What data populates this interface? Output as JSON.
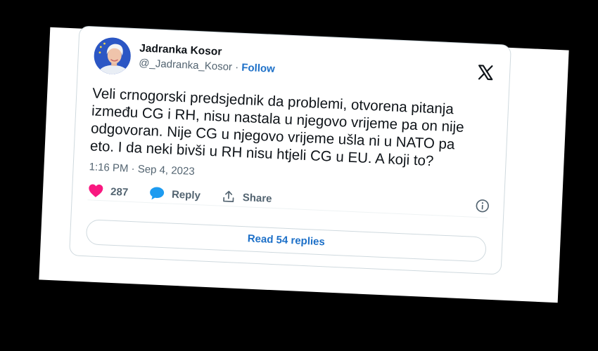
{
  "tweet": {
    "author_name": "Jadranka Kosor",
    "handle": "@_Jadranka_Kosor",
    "separator": " · ",
    "follow_label": "Follow",
    "platform_icon": "x-logo-icon",
    "text": "Veli crnogorski predsjednik da problemi, otvorena pitanja\nizmeđu CG i RH, nisu nastala u njegovo vrijeme pa on nije\nodgovoran. Nije CG u njegovo vrijeme ušla ni u NATO pa\neto. I da neki bivši u RH nisu htjeli CG u EU. A koji to?",
    "timestamp": "1:16 PM · Sep 4, 2023",
    "like_count": "287",
    "reply_label": "Reply",
    "share_label": "Share",
    "read_replies_label": "Read 54 replies"
  },
  "colors": {
    "background": "#000000",
    "paper": "#ffffff",
    "accent_blue": "#1d70c8",
    "like_pink": "#f91880",
    "reply_blue": "#1d9bf0",
    "secondary_text": "#536471",
    "border": "#cfd9de"
  }
}
